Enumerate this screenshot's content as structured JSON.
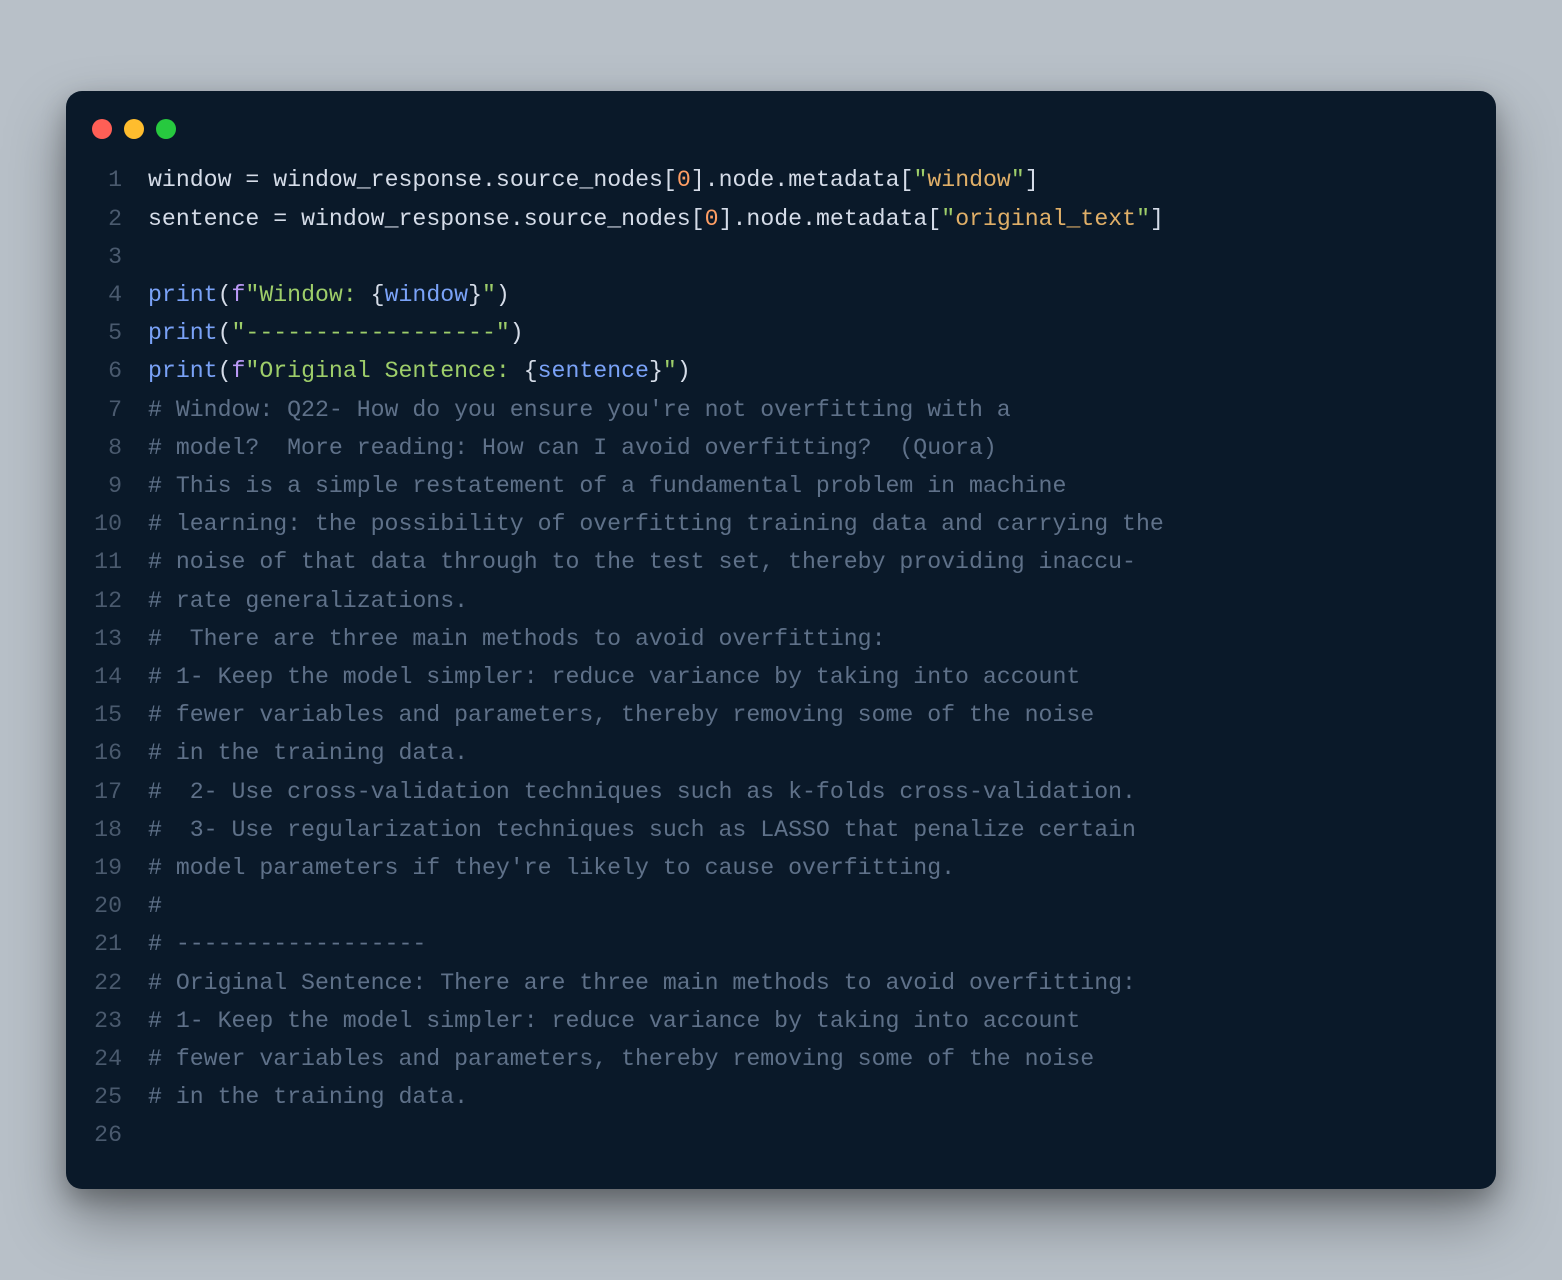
{
  "window_controls": {
    "red": "#ff5f56",
    "yellow": "#ffbd2e",
    "green": "#27c93f"
  },
  "code": {
    "lines": [
      {
        "n": 1,
        "tokens": [
          {
            "t": "window",
            "c": "tk-ident"
          },
          {
            "t": " ",
            "c": "tk-default"
          },
          {
            "t": "=",
            "c": "tk-op"
          },
          {
            "t": " ",
            "c": "tk-default"
          },
          {
            "t": "window_response",
            "c": "tk-ident"
          },
          {
            "t": ".",
            "c": "tk-punct"
          },
          {
            "t": "source_nodes",
            "c": "tk-attr"
          },
          {
            "t": "[",
            "c": "tk-punct"
          },
          {
            "t": "0",
            "c": "tk-num"
          },
          {
            "t": "]",
            "c": "tk-punct"
          },
          {
            "t": ".",
            "c": "tk-punct"
          },
          {
            "t": "node",
            "c": "tk-attr"
          },
          {
            "t": ".",
            "c": "tk-punct"
          },
          {
            "t": "metadata",
            "c": "tk-attr"
          },
          {
            "t": "[",
            "c": "tk-punct"
          },
          {
            "t": "\"",
            "c": "tk-str"
          },
          {
            "t": "window",
            "c": "tk-strkey"
          },
          {
            "t": "\"",
            "c": "tk-str"
          },
          {
            "t": "]",
            "c": "tk-punct"
          }
        ]
      },
      {
        "n": 2,
        "tokens": [
          {
            "t": "sentence",
            "c": "tk-ident"
          },
          {
            "t": " ",
            "c": "tk-default"
          },
          {
            "t": "=",
            "c": "tk-op"
          },
          {
            "t": " ",
            "c": "tk-default"
          },
          {
            "t": "window_response",
            "c": "tk-ident"
          },
          {
            "t": ".",
            "c": "tk-punct"
          },
          {
            "t": "source_nodes",
            "c": "tk-attr"
          },
          {
            "t": "[",
            "c": "tk-punct"
          },
          {
            "t": "0",
            "c": "tk-num"
          },
          {
            "t": "]",
            "c": "tk-punct"
          },
          {
            "t": ".",
            "c": "tk-punct"
          },
          {
            "t": "node",
            "c": "tk-attr"
          },
          {
            "t": ".",
            "c": "tk-punct"
          },
          {
            "t": "metadata",
            "c": "tk-attr"
          },
          {
            "t": "[",
            "c": "tk-punct"
          },
          {
            "t": "\"",
            "c": "tk-str"
          },
          {
            "t": "original_text",
            "c": "tk-strkey"
          },
          {
            "t": "\"",
            "c": "tk-str"
          },
          {
            "t": "]",
            "c": "tk-punct"
          }
        ]
      },
      {
        "n": 3,
        "tokens": []
      },
      {
        "n": 4,
        "tokens": [
          {
            "t": "print",
            "c": "tk-func"
          },
          {
            "t": "(",
            "c": "tk-punct"
          },
          {
            "t": "f",
            "c": "tk-fprefix"
          },
          {
            "t": "\"Window: ",
            "c": "tk-str"
          },
          {
            "t": "{",
            "c": "tk-punct"
          },
          {
            "t": "window",
            "c": "tk-var"
          },
          {
            "t": "}",
            "c": "tk-punct"
          },
          {
            "t": "\"",
            "c": "tk-str"
          },
          {
            "t": ")",
            "c": "tk-punct"
          }
        ]
      },
      {
        "n": 5,
        "tokens": [
          {
            "t": "print",
            "c": "tk-func"
          },
          {
            "t": "(",
            "c": "tk-punct"
          },
          {
            "t": "\"------------------\"",
            "c": "tk-str"
          },
          {
            "t": ")",
            "c": "tk-punct"
          }
        ]
      },
      {
        "n": 6,
        "tokens": [
          {
            "t": "print",
            "c": "tk-func"
          },
          {
            "t": "(",
            "c": "tk-punct"
          },
          {
            "t": "f",
            "c": "tk-fprefix"
          },
          {
            "t": "\"Original Sentence: ",
            "c": "tk-str"
          },
          {
            "t": "{",
            "c": "tk-punct"
          },
          {
            "t": "sentence",
            "c": "tk-var"
          },
          {
            "t": "}",
            "c": "tk-punct"
          },
          {
            "t": "\"",
            "c": "tk-str"
          },
          {
            "t": ")",
            "c": "tk-punct"
          }
        ]
      },
      {
        "n": 7,
        "tokens": [
          {
            "t": "# Window: Q22- How do you ensure you're not overfitting with a",
            "c": "tk-comment"
          }
        ]
      },
      {
        "n": 8,
        "tokens": [
          {
            "t": "# model?  More reading: How can I avoid overfitting?  (Quora)",
            "c": "tk-comment"
          }
        ]
      },
      {
        "n": 9,
        "tokens": [
          {
            "t": "# This is a simple restatement of a fundamental problem in machine",
            "c": "tk-comment"
          }
        ]
      },
      {
        "n": 10,
        "tokens": [
          {
            "t": "# learning: the possibility of overfitting training data and carrying the",
            "c": "tk-comment"
          }
        ]
      },
      {
        "n": 11,
        "tokens": [
          {
            "t": "# noise of that data through to the test set, thereby providing inaccu-",
            "c": "tk-comment"
          }
        ]
      },
      {
        "n": 12,
        "tokens": [
          {
            "t": "# rate generalizations.",
            "c": "tk-comment"
          }
        ]
      },
      {
        "n": 13,
        "tokens": [
          {
            "t": "#  There are three main methods to avoid overfitting:",
            "c": "tk-comment"
          }
        ]
      },
      {
        "n": 14,
        "tokens": [
          {
            "t": "# 1- Keep the model simpler: reduce variance by taking into account",
            "c": "tk-comment"
          }
        ]
      },
      {
        "n": 15,
        "tokens": [
          {
            "t": "# fewer variables and parameters, thereby removing some of the noise",
            "c": "tk-comment"
          }
        ]
      },
      {
        "n": 16,
        "tokens": [
          {
            "t": "# in the training data.",
            "c": "tk-comment"
          }
        ]
      },
      {
        "n": 17,
        "tokens": [
          {
            "t": "#  2- Use cross-validation techniques such as k-folds cross-validation.",
            "c": "tk-comment"
          }
        ]
      },
      {
        "n": 18,
        "tokens": [
          {
            "t": "#  3- Use regularization techniques such as LASSO that penalize certain",
            "c": "tk-comment"
          }
        ]
      },
      {
        "n": 19,
        "tokens": [
          {
            "t": "# model parameters if they're likely to cause overfitting.",
            "c": "tk-comment"
          }
        ]
      },
      {
        "n": 20,
        "tokens": [
          {
            "t": "#",
            "c": "tk-comment"
          }
        ]
      },
      {
        "n": 21,
        "tokens": [
          {
            "t": "# ------------------",
            "c": "tk-comment"
          }
        ]
      },
      {
        "n": 22,
        "tokens": [
          {
            "t": "# Original Sentence: There are three main methods to avoid overfitting:",
            "c": "tk-comment"
          }
        ]
      },
      {
        "n": 23,
        "tokens": [
          {
            "t": "# 1- Keep the model simpler: reduce variance by taking into account",
            "c": "tk-comment"
          }
        ]
      },
      {
        "n": 24,
        "tokens": [
          {
            "t": "# fewer variables and parameters, thereby removing some of the noise",
            "c": "tk-comment"
          }
        ]
      },
      {
        "n": 25,
        "tokens": [
          {
            "t": "# in the training data.",
            "c": "tk-comment"
          }
        ]
      },
      {
        "n": 26,
        "tokens": []
      }
    ]
  }
}
